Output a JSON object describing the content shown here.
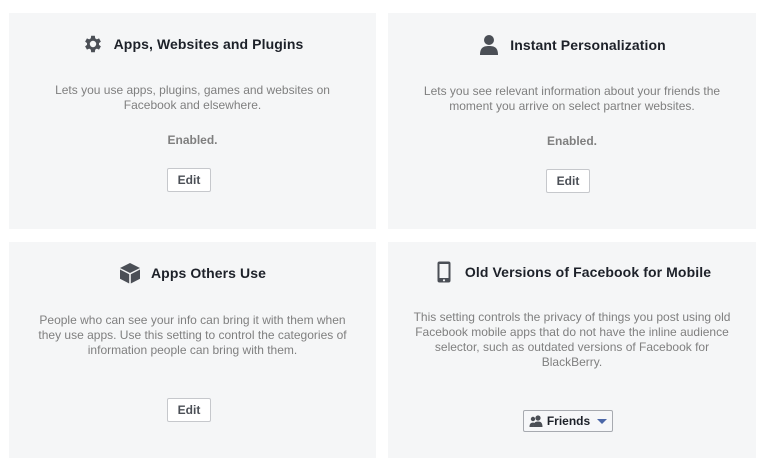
{
  "cards": {
    "apps": {
      "icon": "gear-icon",
      "title": "Apps, Websites and Plugins",
      "description": "Lets you use apps, plugins, games and websites on Facebook and elsewhere.",
      "status": "Enabled.",
      "button": "Edit"
    },
    "instant": {
      "icon": "person-icon",
      "title": "Instant Personalization",
      "description": "Lets you see relevant information about your friends the moment you arrive on select partner websites.",
      "status": "Enabled.",
      "button": "Edit"
    },
    "others": {
      "icon": "cube-icon",
      "title": "Apps Others Use",
      "description": "People who can see your info can bring it with them when they use apps. Use this setting to control the categories of information people can bring with them.",
      "button": "Edit"
    },
    "mobile": {
      "icon": "mobile-phone-icon",
      "title": "Old Versions of Facebook for Mobile",
      "description": "This setting controls the privacy of things you post using old Facebook mobile apps that do not have the inline audience selector, such as outdated versions of Facebook for BlackBerry.",
      "audience": {
        "icon": "friends-icon",
        "label": "Friends",
        "caret": "caret-down-icon"
      }
    }
  },
  "colors": {
    "card_background": "#f5f6f7",
    "title_text": "#1d2129",
    "muted_text": "#7f7f7f",
    "caret": "#4b67a8"
  }
}
